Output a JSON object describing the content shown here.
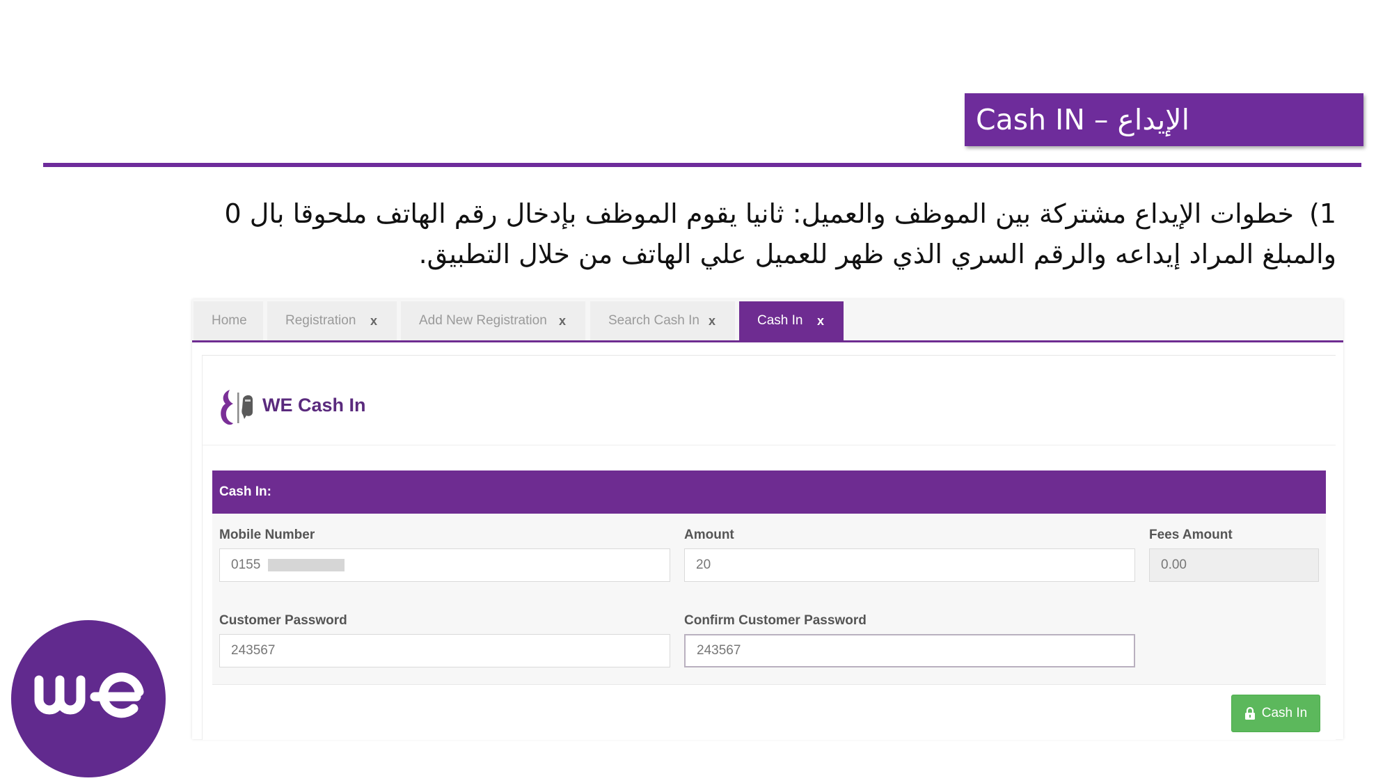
{
  "slide": {
    "title": "Cash IN – الإيداع",
    "step_number": "1)",
    "instruction_text": "خطوات الإيداع مشتركة بين الموظف والعميل: ثانيا يقوم الموظف بإدخال رقم الهاتف ملحوقا بال 0 والمبلغ المراد إيداعه والرقم السري الذي ظهر للعميل علي الهاتف من خلال التطبيق."
  },
  "tabs": [
    {
      "label": "Home",
      "close": ""
    },
    {
      "label": "Registration",
      "close": "x"
    },
    {
      "label": "Add New Registration",
      "close": "x"
    },
    {
      "label": "Search Cash In",
      "close": "x"
    },
    {
      "label": "Cash In",
      "close": "x",
      "active": true
    }
  ],
  "app": {
    "title": "WE Cash In",
    "section_title": "Cash In:"
  },
  "form": {
    "mobile_label": "Mobile Number",
    "mobile_value": "0155",
    "amount_label": "Amount",
    "amount_value": "20",
    "fees_label": "Fees Amount",
    "fees_value": "0.00",
    "password_label": "Customer Password",
    "password_value": "243567",
    "confirm_label": "Confirm Customer Password",
    "confirm_value": "243567",
    "submit_label": "Cash In"
  },
  "colors": {
    "brand_purple": "#6e2c91",
    "button_green": "#5cb85c"
  },
  "icons": {
    "submit": "lock-icon",
    "app_logo": "we-logo-icon",
    "corner_logo": "we-brand-logo"
  }
}
